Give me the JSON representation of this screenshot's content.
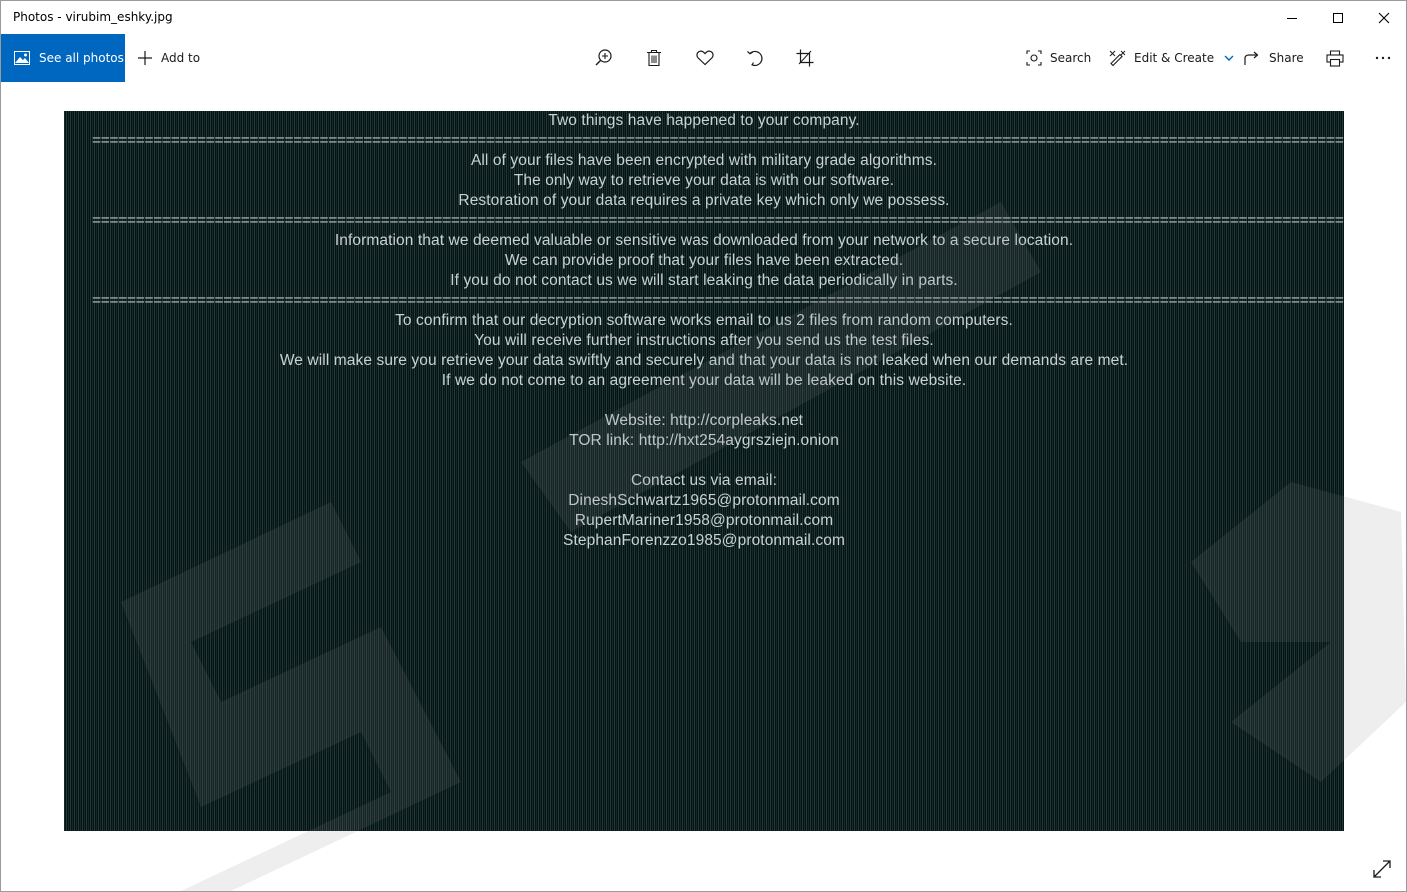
{
  "window": {
    "title": "Photos - virubim_eshky.jpg"
  },
  "toolbar": {
    "see_all_photos": "See all photos",
    "add_to": "Add to",
    "search": "Search",
    "edit_create": "Edit & Create",
    "share": "Share"
  },
  "icons": {
    "photos": "photos-icon",
    "add": "plus-icon",
    "zoom": "zoom-in-icon",
    "delete": "trash-icon",
    "favorite": "heart-icon",
    "rotate": "rotate-icon",
    "crop": "crop-icon",
    "search": "visual-search-icon",
    "edit": "edit-create-icon",
    "share": "share-icon",
    "print": "printer-icon",
    "more": "more-icon",
    "expand": "expand-icon",
    "minimize": "minimize-icon",
    "maximize": "maximize-icon",
    "close": "close-icon"
  },
  "colors": {
    "accent": "#0067c0",
    "note_background": "#0d1a1c",
    "note_text": "#c8d2d2"
  },
  "ransom_note": {
    "lines": [
      "Two things have happened to your company.",
      "================================================================================================================================================================",
      "All of your files have been encrypted with military grade algorithms.",
      "The only way to retrieve your data is with our software.",
      "Restoration of your data requires a private key which only we possess.",
      "================================================================================================================================================================",
      "Information that we deemed valuable or sensitive was downloaded from your network to a secure location.",
      "We can provide proof that your files have been extracted.",
      "If you do not contact us we will start leaking the data periodically in parts.",
      "================================================================================================================================================================",
      "To confirm that our decryption software works email to us 2 files from random computers.",
      "You will receive further instructions after you send us the test files.",
      "We will make sure you retrieve your data swiftly and securely and that your data is not leaked when our demands are met.",
      "If we do not come to an agreement your data will be leaked on this website.",
      "",
      "Website: http://corpleaks.net",
      "TOR link: http://hxt254aygrsziejn.onion",
      "",
      "Contact us via email:",
      "DineshSchwartz1965@protonmail.com",
      "RupertMariner1958@protonmail.com",
      "StephanForenzzo1985@protonmail.com"
    ]
  }
}
